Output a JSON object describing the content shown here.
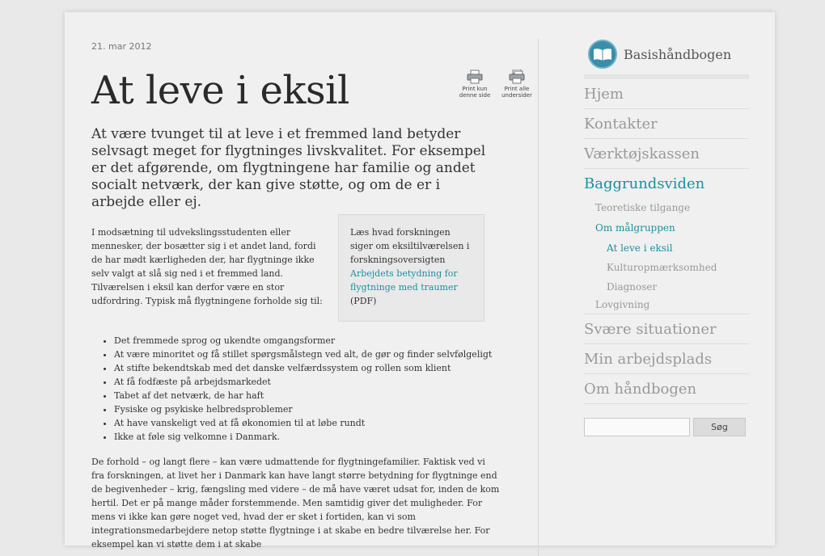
{
  "article": {
    "date": "21. mar 2012",
    "title": "At leve i eksil",
    "lead": "At være tvunget til at leve i et fremmed land betyder selvsagt meget for flygtninges livskvalitet. For eksempel er det afgørende, om flygtningene har familie og andet socialt netværk, der kan give støtte, og om de er i arbejde eller ej.",
    "intro": "I modsætning til udvekslingsstudenten eller mennesker, der bosætter sig i et andet land, fordi de har mødt kærligheden der, har flygtninge ikke selv valgt at slå sig ned i et fremmed land. Tilværelsen i eksil kan derfor være en stor udfordring. Typisk må flygtningene forholde sig til:",
    "bullets": [
      "Det fremmede sprog og ukendte omgangsformer",
      "At være minoritet og få stillet spørgsmålstegn ved alt, de gør og finder selvfølgeligt",
      "At stifte bekendtskab med det danske velfærdssystem og rollen som klient",
      "At få fodfæste på arbejdsmarkedet",
      "Tabet af det netværk, de har haft",
      "Fysiske og psykiske helbredsproblemer",
      "At have vanskeligt ved at få økonomien til at løbe rundt",
      "Ikke at føle sig velkomne i Danmark."
    ],
    "para2": "De forhold – og langt flere – kan være udmattende for flygtningefamilier. Faktisk ved vi fra forskningen, at livet her i Danmark kan have langt større betydning for flygtninge end de begivenheder – krig, fængsling med videre – de må have været udsat for, inden de kom hertil. Det er på mange måder forstemmende. Men samtidig giver det muligheder. For mens vi ikke kan gøre noget ved, hvad der er sket i fortiden, kan vi som integrationsmedarbejdere netop støtte flygtninge i at skabe en bedre tilværelse her. For eksempel kan vi støtte dem i at skabe"
  },
  "print": {
    "this_page": "Print kun denne side",
    "all_pages": "Print alle undersider"
  },
  "infobox": {
    "text": "Læs hvad forskningen siger om eksiltilværelsen i forskningsoversigten",
    "link": "Arbejdets betydning for flygtninge med traumer",
    "suffix": "(PDF)"
  },
  "sidebar": {
    "brand": "Basishåndbogen",
    "nav": {
      "hjem": "Hjem",
      "kontakter": "Kontakter",
      "vaerktoej": "Værktøjskassen",
      "baggrund": "Baggrundsviden",
      "teoretiske": "Teoretiske tilgange",
      "maalgruppen": "Om målgruppen",
      "eksil": "At leve i eksil",
      "kultur": "Kulturopmærksomhed",
      "diagnoser": "Diagnoser",
      "lovgivning": "Lovgivning",
      "svaere": "Svære situationer",
      "arbejdsplads": "Min arbejdsplads",
      "omhaandbogen": "Om håndbogen"
    },
    "search_button": "Søg",
    "search_value": ""
  },
  "colors": {
    "accent": "#1d8fa0",
    "background": "#e9e9e9",
    "card": "#f0f0f0"
  }
}
